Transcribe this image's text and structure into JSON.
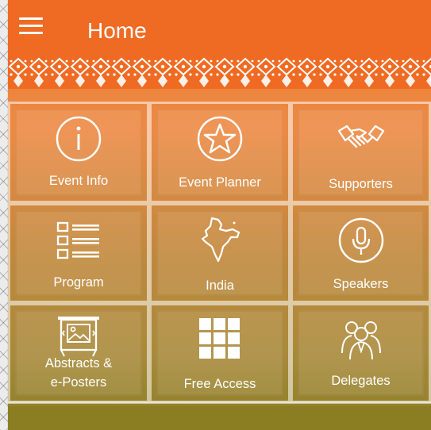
{
  "header": {
    "title": "Home"
  },
  "tiles": [
    {
      "label": "Event Info",
      "icon": "info-icon"
    },
    {
      "label": "Event Planner",
      "icon": "star-icon"
    },
    {
      "label": "Supporters",
      "icon": "handshake-icon"
    },
    {
      "label": "Program",
      "icon": "list-icon"
    },
    {
      "label": "India",
      "icon": "india-map-icon"
    },
    {
      "label": "Speakers",
      "icon": "microphone-icon"
    },
    {
      "label": "Abstracts &",
      "label2": "e-Posters",
      "icon": "poster-icon"
    },
    {
      "label": "Free Access",
      "icon": "grid-icon"
    },
    {
      "label": "Delegates",
      "icon": "people-icon"
    }
  ],
  "colors": {
    "header": "#ef6b23",
    "accent_bottom": "#8a7d22"
  }
}
